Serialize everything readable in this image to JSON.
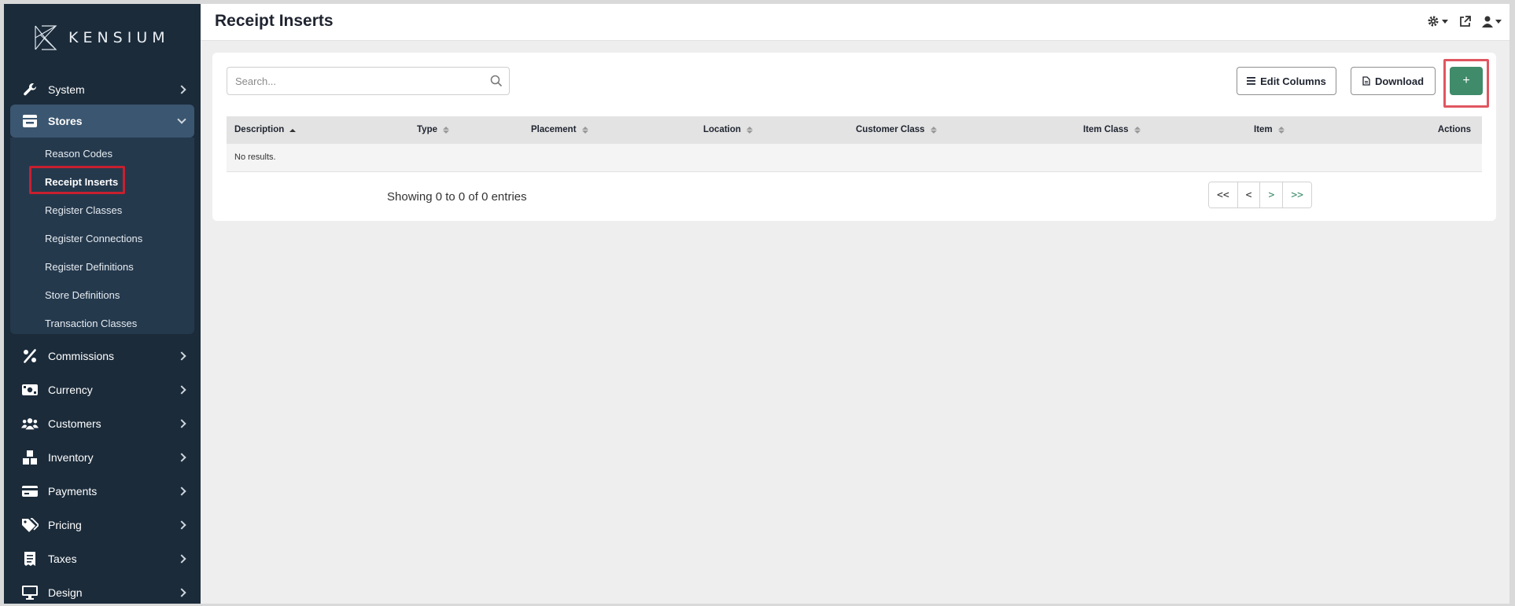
{
  "brand": {
    "name": "KENSIUM"
  },
  "page": {
    "title": "Receipt Inserts"
  },
  "sidebar": {
    "items": [
      {
        "label": "System",
        "icon": "wrench-icon"
      },
      {
        "label": "Stores",
        "icon": "store-icon",
        "expanded": true
      },
      {
        "label": "Commissions",
        "icon": "percent-icon"
      },
      {
        "label": "Currency",
        "icon": "money-icon"
      },
      {
        "label": "Customers",
        "icon": "users-icon"
      },
      {
        "label": "Inventory",
        "icon": "boxes-icon"
      },
      {
        "label": "Payments",
        "icon": "credit-card-icon"
      },
      {
        "label": "Pricing",
        "icon": "tags-icon"
      },
      {
        "label": "Taxes",
        "icon": "receipt-icon"
      },
      {
        "label": "Design",
        "icon": "monitor-icon"
      }
    ],
    "stores_submenu": [
      "Reason Codes",
      "Receipt Inserts",
      "Register Classes",
      "Register Connections",
      "Register Definitions",
      "Store Definitions",
      "Transaction Classes"
    ],
    "selected_submenu": "Receipt Inserts"
  },
  "toolbar": {
    "search_placeholder": "Search...",
    "edit_columns_label": "Edit Columns",
    "download_label": "Download",
    "add_label": "+"
  },
  "table": {
    "columns": [
      "Description",
      "Type",
      "Placement",
      "Location",
      "Customer Class",
      "Item Class",
      "Item",
      "Actions"
    ],
    "sorted_column": "Description",
    "empty_text": "No results."
  },
  "pagination": {
    "summary": "Showing 0 to 0 of 0 entries",
    "first": "<<",
    "prev": "<",
    "next": ">",
    "last": ">>"
  },
  "colors": {
    "sidebar_bg": "#1b2b3a",
    "accent_green": "#3f8b6a",
    "highlight_red": "#c8202f"
  }
}
